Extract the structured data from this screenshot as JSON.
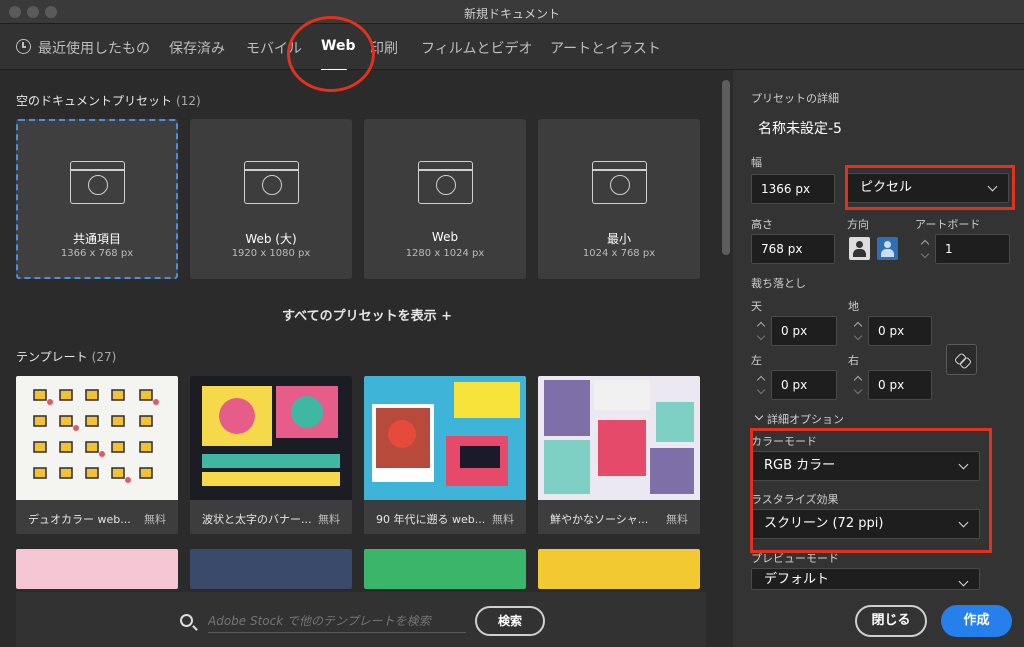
{
  "window": {
    "title": "新規ドキュメント"
  },
  "tabs": [
    {
      "label": "最近使用したもの"
    },
    {
      "label": "保存済み"
    },
    {
      "label": "モバイル"
    },
    {
      "label": "Web"
    },
    {
      "label": "印刷"
    },
    {
      "label": "フィルムとビデオ"
    },
    {
      "label": "アートとイラスト"
    }
  ],
  "active_tab": "Web",
  "presets_section": {
    "title": "空のドキュメントプリセット",
    "count": "(12)"
  },
  "presets": [
    {
      "name": "共通項目",
      "size": "1366 x 768 px"
    },
    {
      "name": "Web (大)",
      "size": "1920 x 1080 px"
    },
    {
      "name": "Web",
      "size": "1280 x 1024 px"
    },
    {
      "name": "最小",
      "size": "1024 x 768 px"
    }
  ],
  "show_all": "すべてのプリセットを表示 +",
  "templates_section": {
    "title": "テンプレート",
    "count": "(27)"
  },
  "templates": [
    {
      "name": "デュオカラー web...",
      "price": "無料"
    },
    {
      "name": "波状と太字のバナー...",
      "price": "無料"
    },
    {
      "name": "90 年代に遡る web...",
      "price": "無料"
    },
    {
      "name": "鮮やかなソーシャ...",
      "price": "無料"
    }
  ],
  "search": {
    "placeholder": "Adobe Stock で他のテンプレートを検索",
    "button": "検索"
  },
  "details": {
    "section_title": "プリセットの詳細",
    "doc_name": "名称未設定-5",
    "width_label": "幅",
    "width_value": "1366 px",
    "unit": "ピクセル",
    "height_label": "高さ",
    "height_value": "768 px",
    "orientation_label": "方向",
    "artboard_label": "アートボード",
    "artboard_value": "1",
    "bleed_label": "裁ち落とし",
    "bleed_top_label": "天",
    "bleed_top": "0 px",
    "bleed_bottom_label": "地",
    "bleed_bottom": "0 px",
    "bleed_left_label": "左",
    "bleed_left": "0 px",
    "bleed_right_label": "右",
    "bleed_right": "0 px",
    "advanced_label": "詳細オプション",
    "color_mode_label": "カラーモード",
    "color_mode": "RGB カラー",
    "raster_label": "ラスタライズ効果",
    "raster": "スクリーン (72 ppi)",
    "preview_label": "プレビューモード",
    "preview": "デフォルト"
  },
  "footer": {
    "close": "閉じる",
    "create": "作成"
  },
  "colors": {
    "accent": "#2680eb",
    "annotation": "#e0321d",
    "selection": "#4a90e2"
  }
}
